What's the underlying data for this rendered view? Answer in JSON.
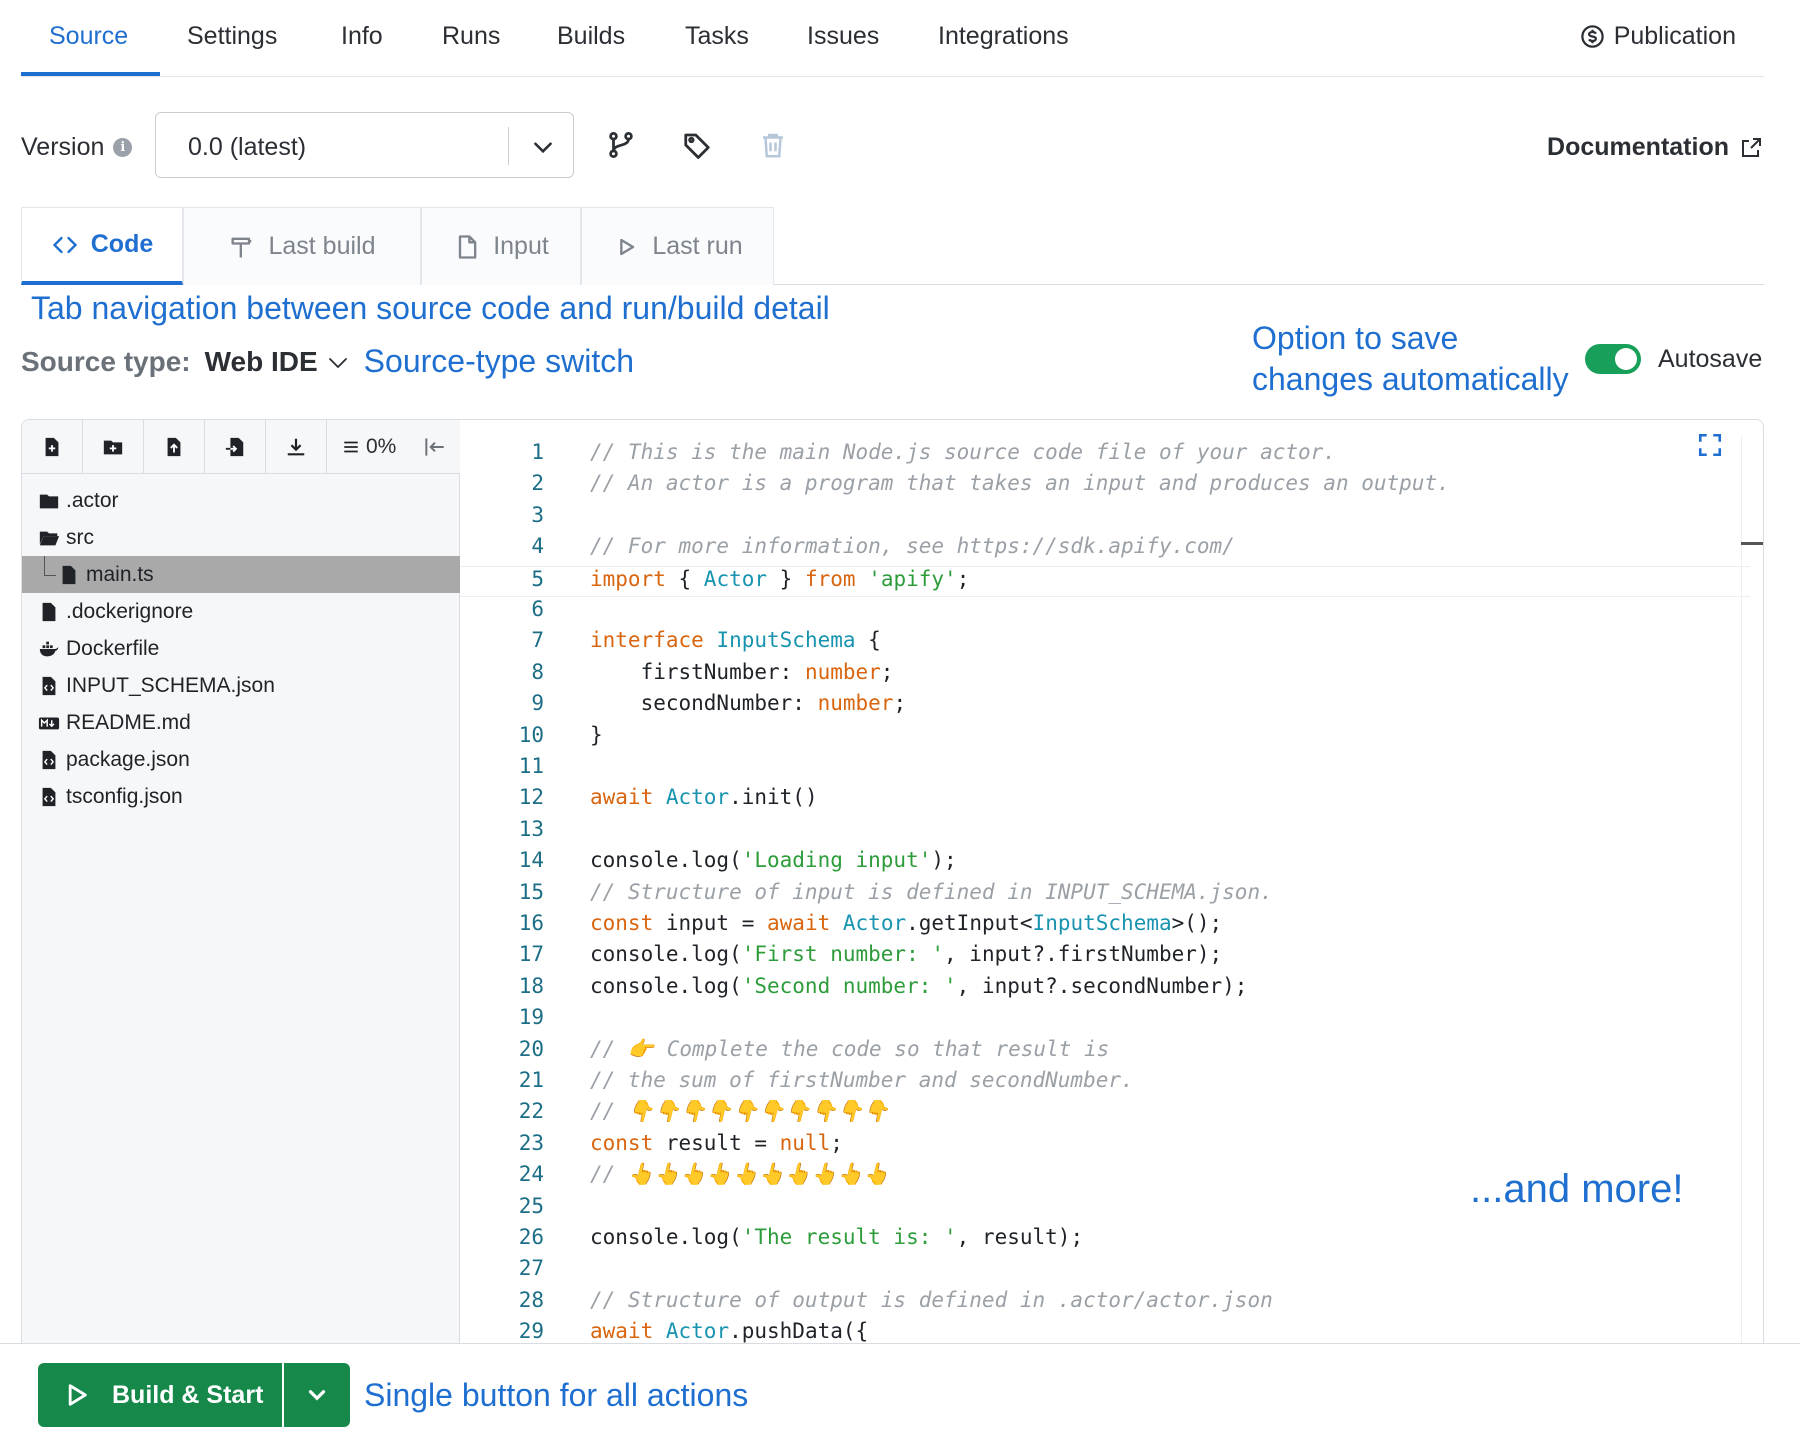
{
  "nav": {
    "tabs": [
      "Source",
      "Settings",
      "Info",
      "Runs",
      "Builds",
      "Tasks",
      "Issues",
      "Integrations"
    ],
    "active": "Source",
    "publication": "Publication"
  },
  "version": {
    "label": "Version",
    "value": "0.0 (latest)"
  },
  "documentation": "Documentation",
  "subtabs": {
    "code": "Code",
    "last_build": "Last build",
    "input": "Input",
    "last_run": "Last run"
  },
  "annotations": {
    "tabs": "Tab navigation between source code and run/build detail",
    "source_type": "Source-type switch",
    "autosave_line1": "Option to save",
    "autosave_line2": "changes automatically",
    "more": "...and more!",
    "single_button": "Single button for all actions"
  },
  "source_type": {
    "label": "Source type:",
    "value": "Web IDE"
  },
  "autosave": {
    "label": "Autosave",
    "enabled": true
  },
  "toolbar": {
    "progress": "0%"
  },
  "files": [
    {
      "name": ".actor",
      "icon": "folder-icon"
    },
    {
      "name": "src",
      "icon": "folder-open-icon"
    },
    {
      "name": "main.ts",
      "icon": "file-icon",
      "child": true,
      "selected": true
    },
    {
      "name": ".dockerignore",
      "icon": "file-icon"
    },
    {
      "name": "Dockerfile",
      "icon": "docker-icon"
    },
    {
      "name": "INPUT_SCHEMA.json",
      "icon": "code-file-icon"
    },
    {
      "name": "README.md",
      "icon": "markdown-icon"
    },
    {
      "name": "package.json",
      "icon": "code-file-icon"
    },
    {
      "name": "tsconfig.json",
      "icon": "code-file-icon"
    }
  ],
  "code": [
    [
      [
        "c",
        "// This is the main Node.js source code file of your actor."
      ]
    ],
    [
      [
        "c",
        "// An actor is a program that takes an input and produces an output."
      ]
    ],
    [],
    [
      [
        "c",
        "// For more information, see https://sdk.apify.com/"
      ]
    ],
    [
      [
        "k",
        "import"
      ],
      [
        "p",
        " { "
      ],
      [
        "t",
        "Actor"
      ],
      [
        "p",
        " } "
      ],
      [
        "k",
        "from"
      ],
      [
        "p",
        " "
      ],
      [
        "s",
        "'apify'"
      ],
      [
        "p",
        ";"
      ]
    ],
    [],
    [
      [
        "k",
        "interface"
      ],
      [
        "p",
        " "
      ],
      [
        "t",
        "InputSchema"
      ],
      [
        "p",
        " {"
      ]
    ],
    [
      [
        "p",
        "    firstNumber: "
      ],
      [
        "n",
        "number"
      ],
      [
        "p",
        ";"
      ]
    ],
    [
      [
        "p",
        "    secondNumber: "
      ],
      [
        "n",
        "number"
      ],
      [
        "p",
        ";"
      ]
    ],
    [
      [
        "p",
        "}"
      ]
    ],
    [],
    [
      [
        "k",
        "await"
      ],
      [
        "p",
        " "
      ],
      [
        "t",
        "Actor"
      ],
      [
        "p",
        ".init()"
      ]
    ],
    [],
    [
      [
        "p",
        "console.log("
      ],
      [
        "s",
        "'Loading input'"
      ],
      [
        "p",
        ");"
      ]
    ],
    [
      [
        "c",
        "// Structure of input is defined in INPUT_SCHEMA.json."
      ]
    ],
    [
      [
        "k",
        "const"
      ],
      [
        "p",
        " input = "
      ],
      [
        "k",
        "await"
      ],
      [
        "p",
        " "
      ],
      [
        "t",
        "Actor"
      ],
      [
        "p",
        ".getInput<"
      ],
      [
        "t",
        "InputSchema"
      ],
      [
        "p",
        ">();"
      ]
    ],
    [
      [
        "p",
        "console.log("
      ],
      [
        "s",
        "'First number: '"
      ],
      [
        "p",
        ", input?.firstNumber);"
      ]
    ],
    [
      [
        "p",
        "console.log("
      ],
      [
        "s",
        "'Second number: '"
      ],
      [
        "p",
        ", input?.secondNumber);"
      ]
    ],
    [],
    [
      [
        "c",
        "// 👉 Complete the code so that result is"
      ]
    ],
    [
      [
        "c",
        "// the sum of firstNumber and secondNumber."
      ]
    ],
    [
      [
        "c",
        "// 👇👇👇👇👇👇👇👇👇👇"
      ]
    ],
    [
      [
        "k",
        "const"
      ],
      [
        "p",
        " result = "
      ],
      [
        "k",
        "null"
      ],
      [
        "p",
        ";"
      ]
    ],
    [
      [
        "c",
        "// 👆👆👆👆👆👆👆👆👆👆"
      ]
    ],
    [],
    [
      [
        "p",
        "console.log("
      ],
      [
        "s",
        "'The result is: '"
      ],
      [
        "p",
        ", result);"
      ]
    ],
    [],
    [
      [
        "c",
        "// Structure of output is defined in .actor/actor.json"
      ]
    ],
    [
      [
        "k",
        "await"
      ],
      [
        "p",
        " "
      ],
      [
        "t",
        "Actor"
      ],
      [
        "p",
        ".pushData({"
      ]
    ]
  ],
  "current_line": 5,
  "build_button": {
    "label": "Build & Start"
  },
  "colors": {
    "accent": "#1f6fd0",
    "success": "#16884a",
    "toggle": "#18a05a"
  }
}
